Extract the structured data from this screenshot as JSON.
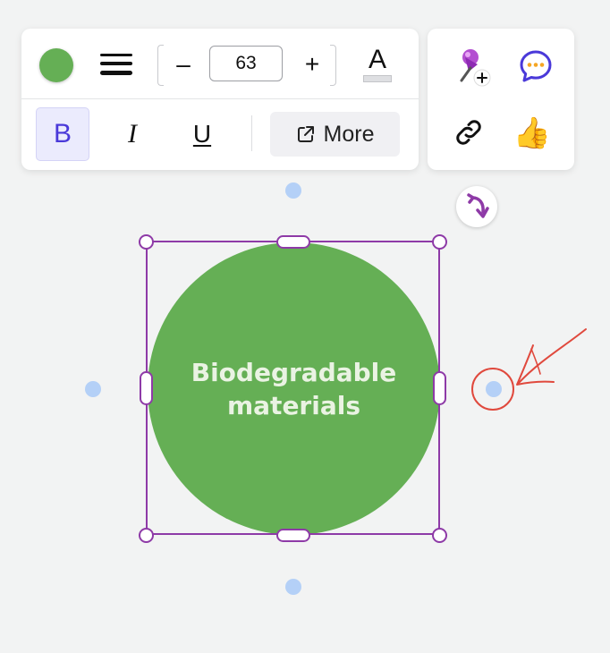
{
  "toolbar": {
    "fill_color": "#65af55",
    "line_style_icon": "line-weight-icon",
    "font_size": "63",
    "decrease_label": "–",
    "increase_label": "+",
    "text_color_letter": "A",
    "bold_label": "B",
    "italic_label": "I",
    "underline_label": "U",
    "more_label": "More",
    "more_icon": "external-link-icon",
    "active_color": "#4a39d9"
  },
  "side_toolbar": {
    "pin_icon": "pin-add-icon",
    "comment_icon": "comment-icon",
    "link_icon": "link-icon",
    "like_icon": "thumbs-up-icon",
    "like_glyph": "👍"
  },
  "canvas": {
    "shape_label_line1": "Biodegradable",
    "shape_label_line2": "materials",
    "shape_color": "#65af55",
    "selection_color": "#8e3aa7",
    "connector_color": "#b4d0f7",
    "rotate_icon": "rotate-icon",
    "annotation_color": "#e0493d"
  }
}
